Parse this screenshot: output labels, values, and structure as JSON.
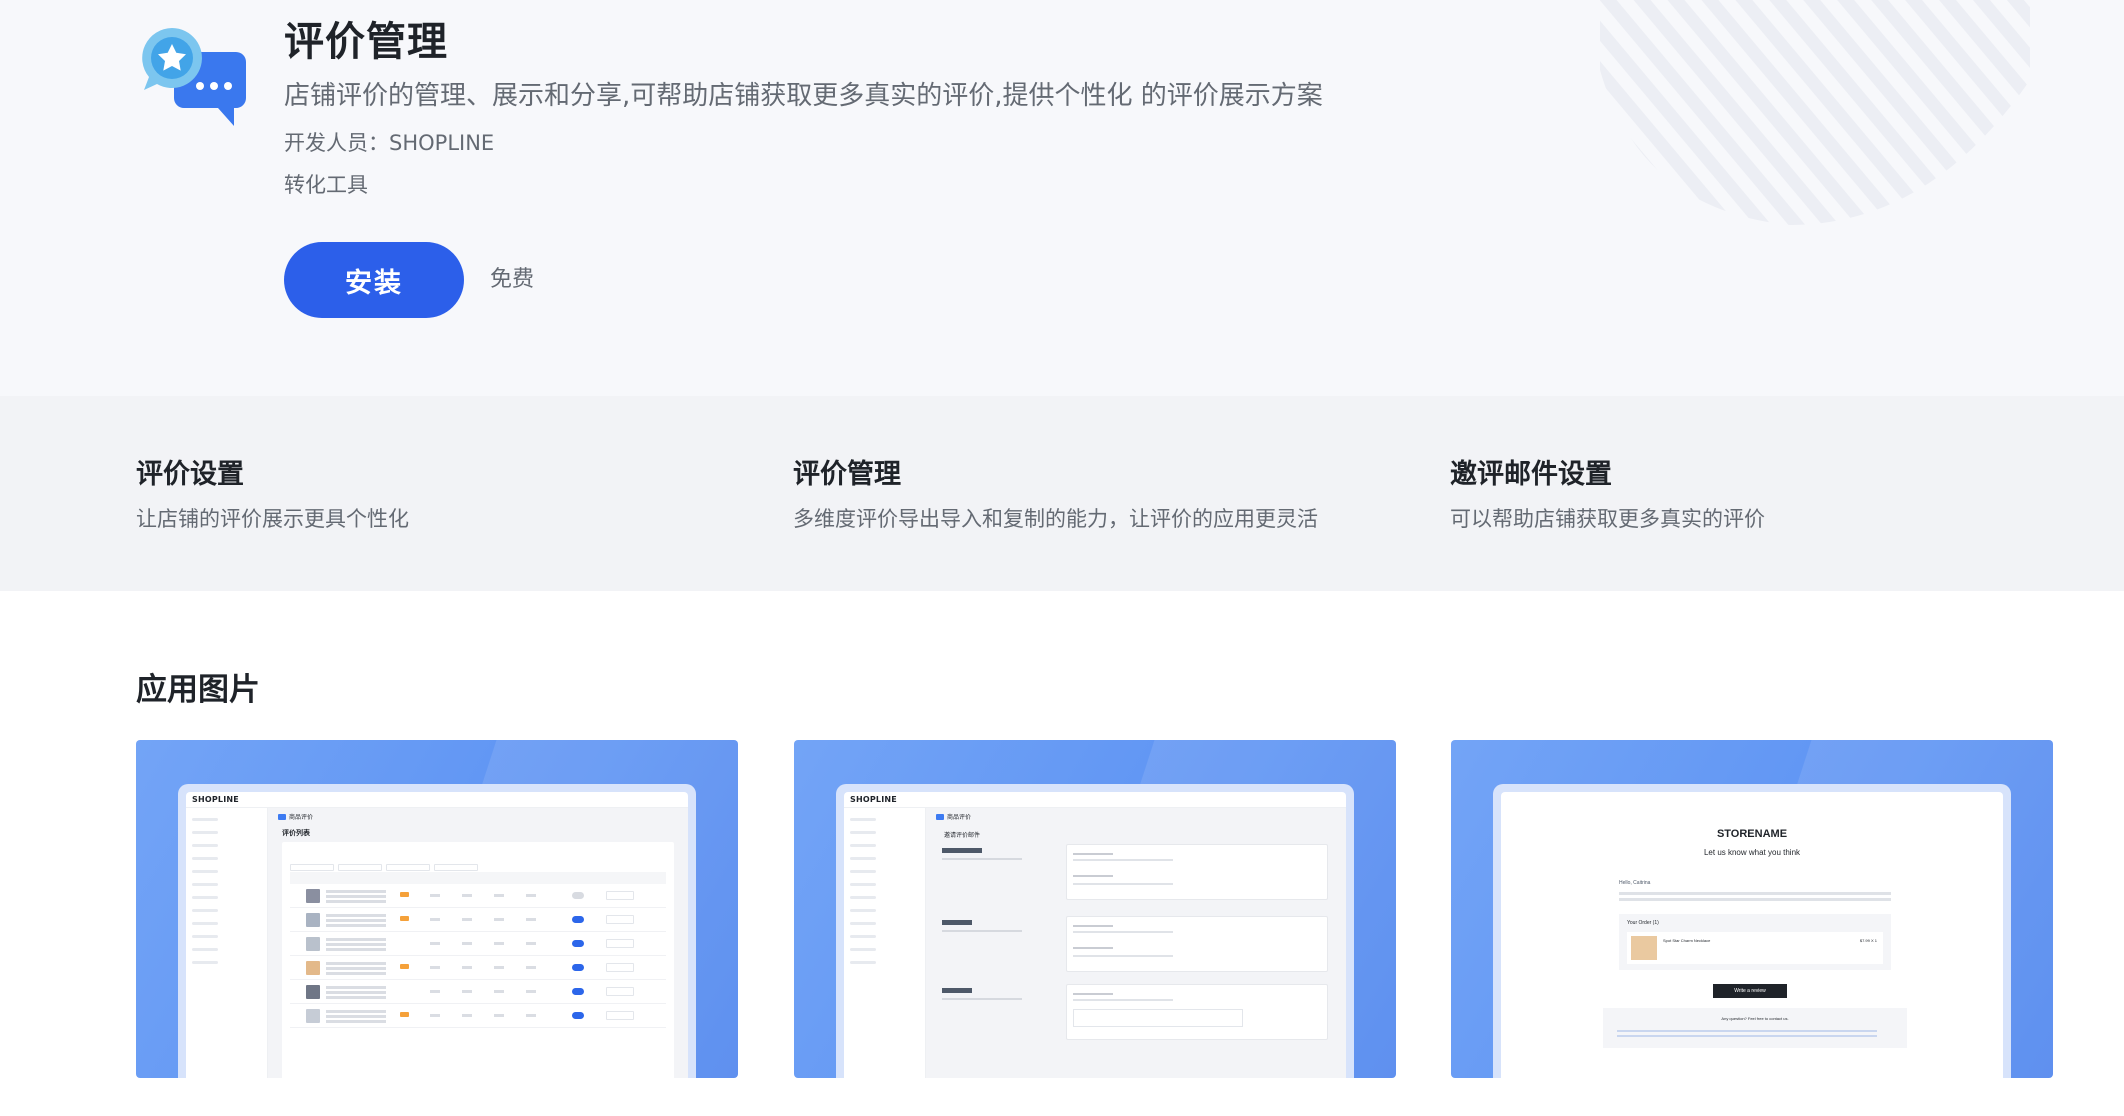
{
  "app": {
    "title": "评价管理",
    "description": "店铺评价的管理、展示和分享,可帮助店铺获取更多真实的评价,提供个性化 的评价展示方案",
    "developer": "开发人员：SHOPLINE",
    "category": "转化工具",
    "install_label": "安装",
    "price": "免费",
    "icon": "review-chat-star-icon"
  },
  "colors": {
    "accent": "#2c5fea",
    "title": "#1f2329",
    "muted": "#646a73",
    "hero_bg": "#f7f8fb",
    "features_bg": "#f2f3f6",
    "shot_blue": "#5d93f3"
  },
  "features": [
    {
      "title": "评价设置",
      "description": "让店铺的评价展示更具个性化"
    },
    {
      "title": "评价管理",
      "description": "多维度评价导出导入和复制的能力，让评价的应用更灵活"
    },
    {
      "title": "邀评邮件设置",
      "description": "可以帮助店铺获取更多真实的评价"
    }
  ],
  "screenshots": {
    "section_title": "应用图片",
    "items": [
      {
        "logo": "SHOPLINE",
        "heading": "商品评价",
        "subheading": "评价列表"
      },
      {
        "logo": "SHOPLINE",
        "heading": "商品评价",
        "subheading": "邀请评价邮件"
      },
      {
        "store": "STORENAME",
        "tagline": "Let us know what you think",
        "greeting": "Hello, Caitrina",
        "order_title": "Your Order (1)",
        "item_name": "Spot Star Charm Necklace",
        "item_price": "$7.99  X 1",
        "cta": "Write a review",
        "footer": "Any question? Feel free to contact us."
      }
    ]
  }
}
